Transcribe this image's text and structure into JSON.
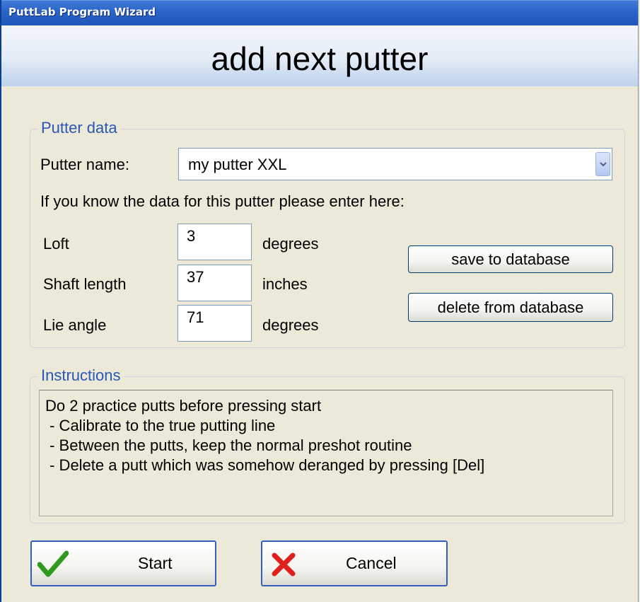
{
  "window": {
    "title": "PuttLab Program Wizard"
  },
  "banner": {
    "title": "add next putter"
  },
  "putter_data": {
    "legend": "Putter data",
    "name_label": "Putter name:",
    "name_value": "my putter XXL",
    "hint": "If you know the data for this putter please enter here:",
    "fields": [
      {
        "label": "Loft",
        "value": "3",
        "unit": "degrees"
      },
      {
        "label": "Shaft length",
        "value": "37",
        "unit": "inches"
      },
      {
        "label": "Lie angle",
        "value": "71",
        "unit": "degrees"
      }
    ],
    "save_button": "save to database",
    "delete_button": "delete from database"
  },
  "instructions": {
    "legend": "Instructions",
    "lines": [
      "Do 2 practice putts before pressing start",
      " - Calibrate to the true putting line",
      " - Between the putts, keep the normal preshot routine",
      " - Delete a putt which was somehow deranged by pressing [Del]"
    ]
  },
  "actions": {
    "start_label": "Start",
    "cancel_label": "Cancel"
  },
  "icons": {
    "check": "check-icon",
    "cross": "cross-icon",
    "dropdown": "chevron-down-icon"
  },
  "colors": {
    "titlebar": "#2a64c8",
    "legend": "#2a57b5",
    "check_green": "#2e9a1e",
    "cross_red": "#e0201c"
  }
}
